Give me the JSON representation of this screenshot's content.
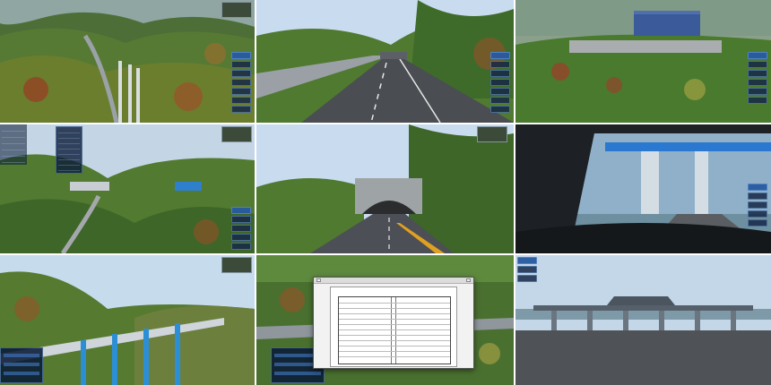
{
  "collage": {
    "tiles": [
      {
        "id": "tile-1",
        "scene": "aerial-highway-viaduct-forest"
      },
      {
        "id": "tile-2",
        "scene": "highway-entering-tunnel"
      },
      {
        "id": "tile-3",
        "scene": "building-on-forested-hill"
      },
      {
        "id": "tile-4",
        "scene": "aerial-viaduct-valley-with-menu"
      },
      {
        "id": "tile-5",
        "scene": "tunnel-portal-front-view"
      },
      {
        "id": "tile-6",
        "scene": "driver-view-toll-canopy"
      },
      {
        "id": "tile-7",
        "scene": "blue-viaduct-mountains"
      },
      {
        "id": "tile-8",
        "scene": "document-viewer-overlay"
      },
      {
        "id": "tile-9",
        "scene": "toll-station-gate"
      }
    ],
    "ui": {
      "side_menu_icon": "list-menu-icon",
      "minimap_icon": "minimap-icon",
      "document_icon": "document-icon"
    },
    "colors": {
      "panel_bg": "#162846",
      "panel_border": "#78aae6",
      "sky": "#c9dcef",
      "forest": "#3f6b2a",
      "road": "#4a4d52"
    }
  }
}
